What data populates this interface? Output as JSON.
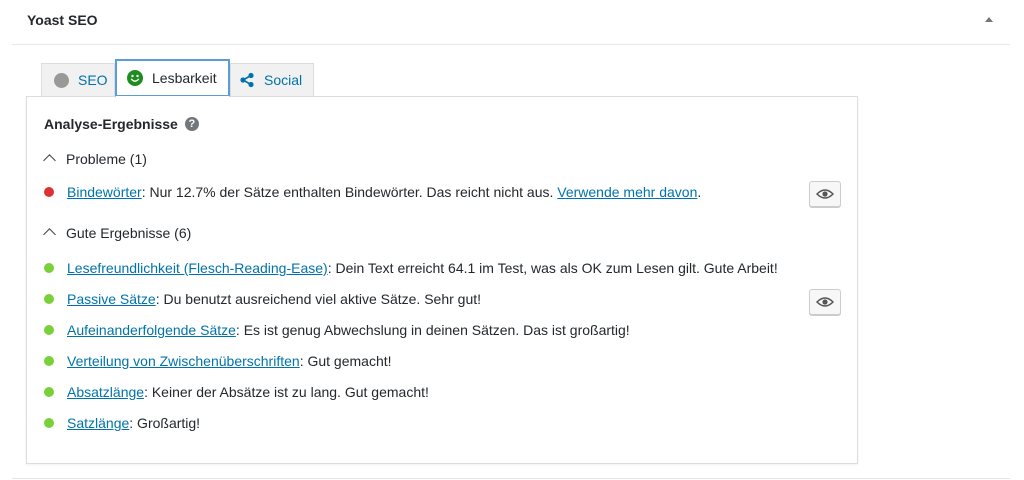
{
  "metabox": {
    "title": "Yoast SEO"
  },
  "tabs": [
    {
      "label": "SEO",
      "icon": "grey-circle-icon"
    },
    {
      "label": "Lesbarkeit",
      "icon": "smiley-icon",
      "active": true
    },
    {
      "label": "Social",
      "icon": "share-icon"
    }
  ],
  "analysis": {
    "heading": "Analyse-Ergebnisse",
    "help_symbol": "?",
    "problems": {
      "label": "Probleme (1)",
      "items": [
        {
          "link": "Bindewörter",
          "text": ": Nur 12.7% der Sätze enthalten Bindewörter. Das reicht nicht aus. ",
          "link2": "Verwende mehr davon",
          "end": "."
        }
      ]
    },
    "good": {
      "label": "Gute Ergebnisse (6)",
      "items": [
        {
          "link": "Lesefreundlichkeit (Flesch-Reading-Ease)",
          "text": ": Dein Text erreicht 64.1 im Test, was als OK zum Lesen gilt. Gute Arbeit!"
        },
        {
          "link": "Passive Sätze",
          "text": ": Du benutzt ausreichend viel aktive Sätze. Sehr gut!"
        },
        {
          "link": "Aufeinanderfolgende Sätze",
          "text": ": Es ist genug Abwechslung in deinen Sätzen. Das ist großartig!"
        },
        {
          "link": "Verteilung von Zwischenüberschriften",
          "text": ": Gut gemacht!"
        },
        {
          "link": "Absatzlänge",
          "text": ": Keiner der Absätze ist zu lang. Gut gemacht!"
        },
        {
          "link": "Satzlänge",
          "text": ": Großartig!"
        }
      ]
    }
  },
  "colors": {
    "link": "#0073aa",
    "problem": "#dc3232",
    "good": "#7ad03a",
    "active_tab_border": "#5b9dd9",
    "smiley": "#1e8c1e"
  }
}
